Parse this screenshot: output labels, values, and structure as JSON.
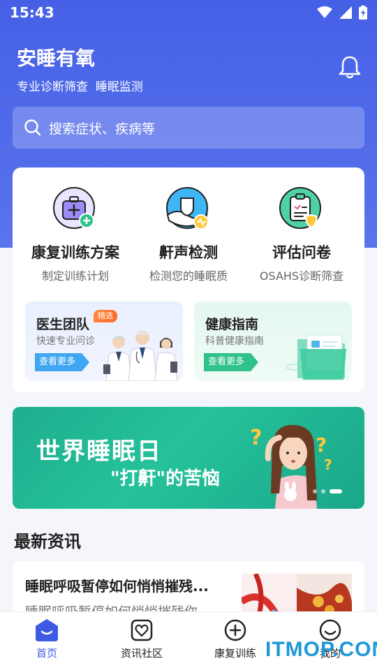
{
  "status_bar": {
    "time": "15:43"
  },
  "header": {
    "app_title": "安睡有氧",
    "subtitle": "专业诊断筛查  睡眠监测"
  },
  "search": {
    "placeholder": "搜索症状、疾病等"
  },
  "services": [
    {
      "title": "康复训练方案",
      "desc": "制定训练计划",
      "icon": "rehab-kit-icon"
    },
    {
      "title": "鼾声检测",
      "desc": "检测您的睡眠质",
      "icon": "snore-shield-icon"
    },
    {
      "title": "评估问卷",
      "desc": "OSAHS诊断筛查",
      "icon": "questionnaire-icon"
    }
  ],
  "doctor_card": {
    "title": "医生团队",
    "badge": "精选",
    "desc": "快速专业问诊",
    "button": "查看更多"
  },
  "guide_card": {
    "title": "健康指南",
    "desc": "科普健康指南",
    "button": "查看更多"
  },
  "banner": {
    "title": "世界睡眠日",
    "subtitle": "\"打鼾\"的苦恼",
    "slide_count": 3,
    "active_slide": 3
  },
  "news_section": {
    "title": "最新资讯"
  },
  "news": [
    {
      "title": "睡眠呼吸暂停如何悄悄摧残...",
      "summary": "睡眠呼吸暂停如何悄悄摧残你"
    }
  ],
  "tabs": [
    {
      "label": "首页",
      "active": true,
      "icon": "home-icon"
    },
    {
      "label": "资讯社区",
      "active": false,
      "icon": "community-icon"
    },
    {
      "label": "康复训练",
      "active": false,
      "icon": "rehab-icon"
    },
    {
      "label": "我的",
      "active": false,
      "icon": "profile-icon"
    }
  ],
  "watermark": "ITMOP.COM",
  "colors": {
    "primary": "#4560e6",
    "banner": "#1fae8f",
    "tab_active": "#3d5ae3"
  }
}
